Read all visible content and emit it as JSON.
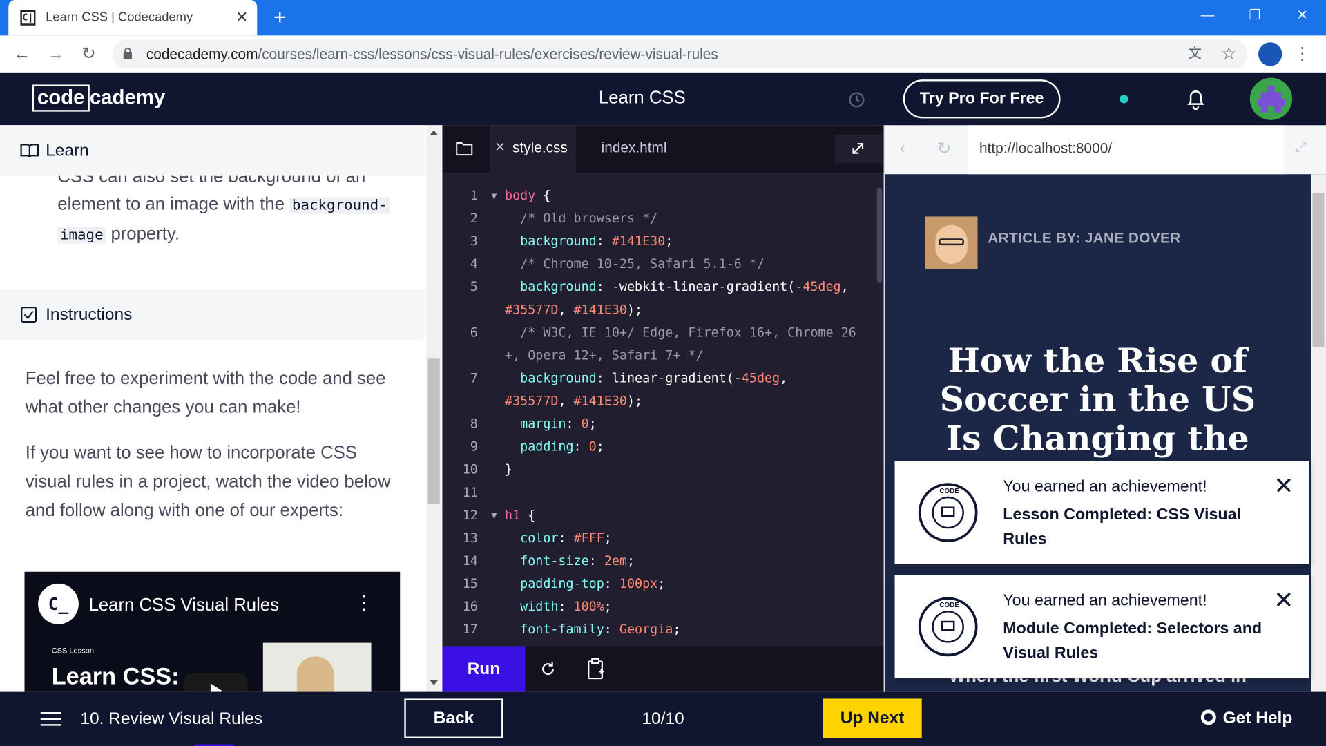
{
  "browser": {
    "tab_title": "Learn CSS | Codecademy",
    "tab_favicon": "C|",
    "url_host": "codecademy.com",
    "url_path": "/courses/learn-css/lessons/css-visual-rules/exercises/review-visual-rules"
  },
  "header": {
    "logo_boxed": "code",
    "logo_rest": "cademy",
    "course_title": "Learn CSS",
    "pro_button": "Try Pro For Free",
    "status_color": "#1fd1c1"
  },
  "left": {
    "learn_title": "Learn",
    "bullet_cut": "CSS can also set the background of an",
    "bullet_line2_prefix": "element to an image with the",
    "bullet_code1": "background-",
    "bullet_code2": "image",
    "bullet_line3_suffix": "property.",
    "instructions_title": "Instructions",
    "para1": "Feel free to experiment with the code and see what other changes you can make!",
    "para2": "If you want to see how to incorporate CSS visual rules in a project, watch the video below and follow along with one of our experts:",
    "video": {
      "logo": "C_",
      "title": "Learn CSS Visual Rules",
      "small_label": "CSS Lesson",
      "big_label": "Learn CSS:",
      "menu": "⋮"
    }
  },
  "editor": {
    "tabs": [
      {
        "label": "style.css",
        "active": true
      },
      {
        "label": "index.html",
        "active": false
      }
    ],
    "run_label": "Run",
    "lines": [
      {
        "n": "1",
        "fold": true,
        "parts": [
          [
            "sel",
            "body"
          ],
          [
            "w",
            " {"
          ]
        ]
      },
      {
        "n": "2",
        "parts": [
          [
            "cm",
            "  /* Old browsers */"
          ]
        ]
      },
      {
        "n": "3",
        "parts": [
          [
            "prop",
            "  background"
          ],
          [
            "w",
            ": "
          ],
          [
            "val",
            "#141E30"
          ],
          [
            "w",
            ";"
          ]
        ]
      },
      {
        "n": "4",
        "parts": [
          [
            "cm",
            "  /* Chrome 10-25, Safari 5.1-6 */"
          ]
        ]
      },
      {
        "n": "5",
        "parts": [
          [
            "prop",
            "  background"
          ],
          [
            "w",
            ": -webkit-linear-gradient(-"
          ],
          [
            "val",
            "45deg"
          ],
          [
            "w",
            ","
          ]
        ]
      },
      {
        "n": "",
        "parts": [
          [
            "val",
            "#35577D"
          ],
          [
            "w",
            ", "
          ],
          [
            "val",
            "#141E30"
          ],
          [
            "w",
            ");"
          ]
        ]
      },
      {
        "n": "6",
        "parts": [
          [
            "cm",
            "  /* W3C, IE 10+/ Edge, Firefox 16+, Chrome 26"
          ]
        ]
      },
      {
        "n": "",
        "parts": [
          [
            "cm",
            "+, Opera 12+, Safari 7+ */"
          ]
        ]
      },
      {
        "n": "7",
        "parts": [
          [
            "prop",
            "  background"
          ],
          [
            "w",
            ": linear-gradient(-"
          ],
          [
            "val",
            "45deg"
          ],
          [
            "w",
            ","
          ]
        ]
      },
      {
        "n": "",
        "parts": [
          [
            "val",
            "#35577D"
          ],
          [
            "w",
            ", "
          ],
          [
            "val",
            "#141E30"
          ],
          [
            "w",
            ");"
          ]
        ]
      },
      {
        "n": "8",
        "parts": [
          [
            "prop",
            "  margin"
          ],
          [
            "w",
            ": "
          ],
          [
            "val",
            "0"
          ],
          [
            "w",
            ";"
          ]
        ]
      },
      {
        "n": "9",
        "parts": [
          [
            "prop",
            "  padding"
          ],
          [
            "w",
            ": "
          ],
          [
            "val",
            "0"
          ],
          [
            "w",
            ";"
          ]
        ]
      },
      {
        "n": "10",
        "parts": [
          [
            "w",
            "}"
          ]
        ]
      },
      {
        "n": "11",
        "parts": []
      },
      {
        "n": "12",
        "fold": true,
        "parts": [
          [
            "sel",
            "h1"
          ],
          [
            "w",
            " {"
          ]
        ]
      },
      {
        "n": "13",
        "parts": [
          [
            "prop",
            "  color"
          ],
          [
            "w",
            ": "
          ],
          [
            "val",
            "#FFF"
          ],
          [
            "w",
            ";"
          ]
        ]
      },
      {
        "n": "14",
        "parts": [
          [
            "prop",
            "  font-size"
          ],
          [
            "w",
            ": "
          ],
          [
            "val",
            "2em"
          ],
          [
            "w",
            ";"
          ]
        ]
      },
      {
        "n": "15",
        "parts": [
          [
            "prop",
            "  padding-top"
          ],
          [
            "w",
            ": "
          ],
          [
            "val",
            "100px"
          ],
          [
            "w",
            ";"
          ]
        ]
      },
      {
        "n": "16",
        "parts": [
          [
            "prop",
            "  width"
          ],
          [
            "w",
            ": "
          ],
          [
            "val",
            "100%"
          ],
          [
            "w",
            ";"
          ]
        ]
      },
      {
        "n": "17",
        "parts": [
          [
            "prop",
            "  font-family"
          ],
          [
            "w",
            ": "
          ],
          [
            "val",
            "Georgia"
          ],
          [
            "w",
            ";"
          ]
        ]
      }
    ]
  },
  "preview": {
    "url": "http://localhost:8000/",
    "byline": "ARTICLE BY: JANE DOVER",
    "headline": "How the Rise of Soccer in the US Is Changing the Face",
    "peek_text": "When the first World Cup arrived in"
  },
  "toasts": [
    {
      "line1": "You earned an achievement!",
      "line2": "Lesson Completed: CSS Visual Rules"
    },
    {
      "line1": "You earned an achievement!",
      "line2": "Module Completed: Selectors and Visual Rules"
    }
  ],
  "footer": {
    "lesson_name": "10. Review Visual Rules",
    "back_label": "Back",
    "progress": "10/10",
    "next_label": "Up Next",
    "help_label": "Get Help"
  }
}
